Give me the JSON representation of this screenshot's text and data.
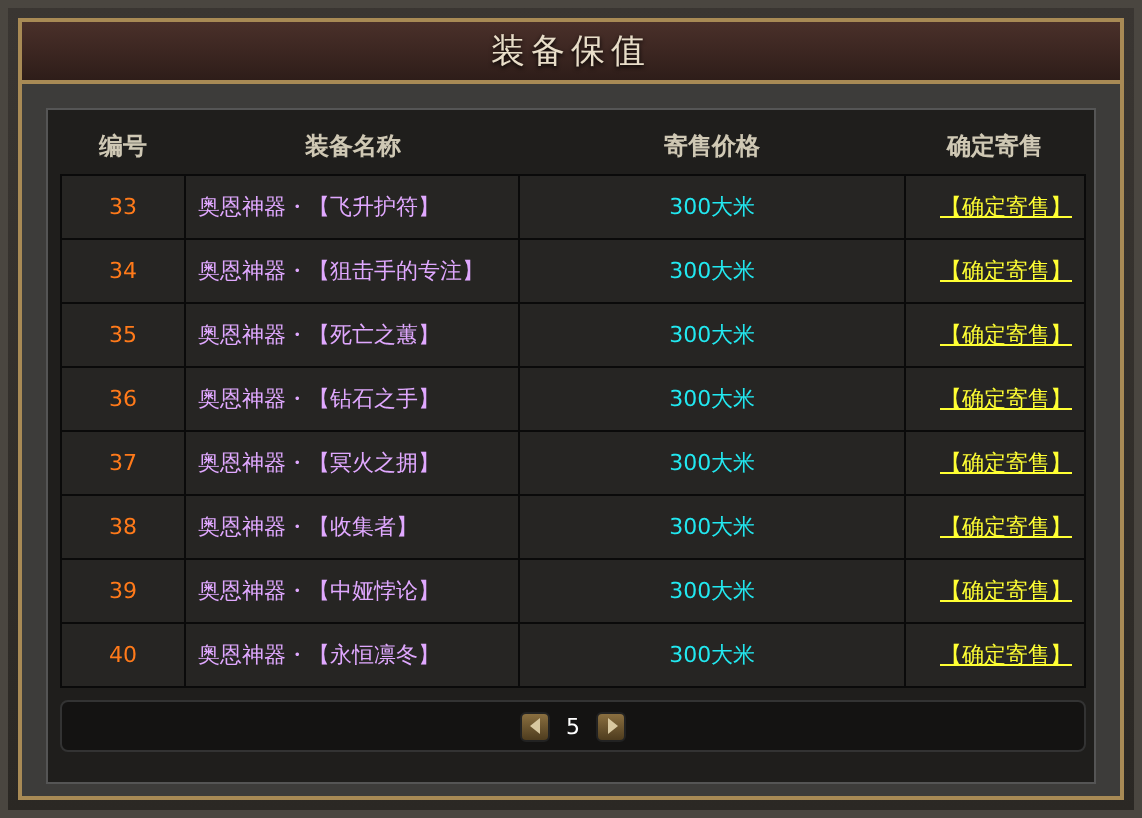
{
  "window": {
    "title": "装备保值"
  },
  "table": {
    "columns": [
      "编号",
      "装备名称",
      "寄售价格",
      "确定寄售"
    ],
    "rows": [
      {
        "number": "33",
        "name": "奥恩神器・【飞升护符】",
        "price": "300大米",
        "action": "【确定寄售】"
      },
      {
        "number": "34",
        "name": "奥恩神器・【狙击手的专注】",
        "price": "300大米",
        "action": "【确定寄售】"
      },
      {
        "number": "35",
        "name": "奥恩神器・【死亡之蕙】",
        "price": "300大米",
        "action": "【确定寄售】"
      },
      {
        "number": "36",
        "name": "奥恩神器・【钻石之手】",
        "price": "300大米",
        "action": "【确定寄售】"
      },
      {
        "number": "37",
        "name": "奥恩神器・【冥火之拥】",
        "price": "300大米",
        "action": "【确定寄售】"
      },
      {
        "number": "38",
        "name": "奥恩神器・【收集者】",
        "price": "300大米",
        "action": "【确定寄售】"
      },
      {
        "number": "39",
        "name": "奥恩神器・【中娅悖论】",
        "price": "300大米",
        "action": "【确定寄售】"
      },
      {
        "number": "40",
        "name": "奥恩神器・【永恒凛冬】",
        "price": "300大米",
        "action": "【确定寄售】"
      }
    ]
  },
  "pagination": {
    "page": "5"
  }
}
